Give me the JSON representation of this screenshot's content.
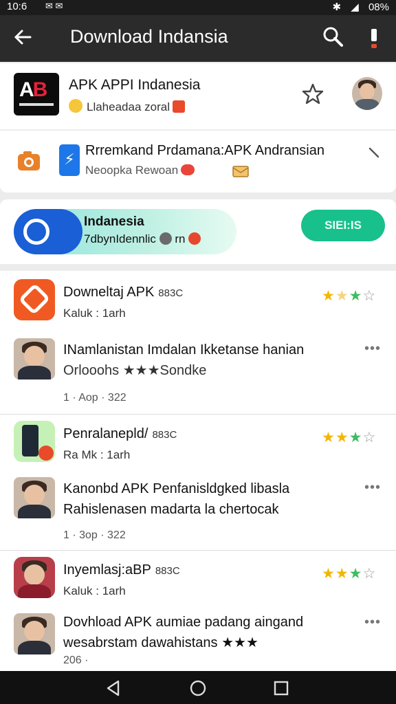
{
  "status": {
    "time": "10:6 ",
    "signal": "08%",
    "icons": "✉ ✉"
  },
  "appbar": {
    "title": "Download Indansia"
  },
  "header": {
    "app_name": "APK APPI Indanesia",
    "subtitle": "Llaheadaa zoral"
  },
  "suggestion": {
    "title": "Rrremkand Prdamana:APK Andransian",
    "subtitle": "Neoopka Rewoan"
  },
  "promo": {
    "title": "Indanesia",
    "subtitle": "7dbynIdennlic",
    "subtitle_tail": "rn",
    "button": "SIEI:IS"
  },
  "feed": {
    "items": [
      {
        "title": "Downeltaj APK",
        "tag": "883C",
        "sub": "Kaluk : 1arh",
        "rating": 3.5
      },
      {
        "title": "Penralanepld/",
        "tag": "883C",
        "sub": "Ra Mk : 1arh",
        "rating": 3.5
      },
      {
        "title": "Inyemlasj:aBP",
        "tag": "883C",
        "sub": "Kaluk : 1arh",
        "rating": 3.5
      }
    ],
    "posts": [
      {
        "line1": "INamlanistan Imdalan Ikketanse hanian",
        "line2": "Orlooohs ★★★Sondke",
        "meta": "1 · Aop · 322"
      },
      {
        "line1": "Kanonbd APK  Penfanisldgked libasla",
        "line2": "Rahislenasen   madarta la chertocak",
        "meta": "1 · 3op · 322"
      },
      {
        "line1": "Dovhload APK   aumiae padang aingand",
        "line2": "wesabrstam dawahistans   ★★★",
        "meta": "206 ·"
      }
    ]
  },
  "colors": {
    "appbar": "#2b2b2b",
    "accent_green": "#18c08c",
    "accent_blue": "#1a5fd6",
    "orange": "#f05a22"
  },
  "icons": [
    "back-arrow-icon",
    "search-icon",
    "more-vert-icon",
    "star-outline-icon",
    "camera-icon",
    "chevron-icon",
    "nav-back-icon",
    "nav-home-icon",
    "nav-recents-icon"
  ]
}
